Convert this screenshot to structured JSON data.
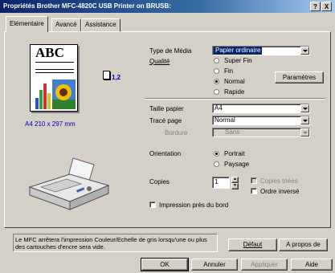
{
  "window": {
    "title": "Propriétés Brother MFC-4820C USB Printer on BRUSB:",
    "help_btn": "?",
    "close_btn": "X"
  },
  "tabs": [
    {
      "label": "Elémentaire",
      "active": true
    },
    {
      "label": "Avancé",
      "active": false
    },
    {
      "label": "Assistance",
      "active": false
    }
  ],
  "preview": {
    "logo_text": "ABC",
    "copies_badge": "1,2",
    "paper_label": "A4 210 x 297 mm"
  },
  "media": {
    "label": "Type de Média",
    "value": "Papier ordinaire"
  },
  "quality": {
    "label": "Qualité",
    "options": [
      {
        "label": "Super Fin",
        "selected": false
      },
      {
        "label": "Fin",
        "selected": false
      },
      {
        "label": "Normal",
        "selected": true
      },
      {
        "label": "Rapide",
        "selected": false
      }
    ],
    "settings_button": "Paramètres"
  },
  "paper_size": {
    "label": "Taille papier",
    "value": "A4"
  },
  "layout": {
    "label": "Tracé page",
    "value": "Normal"
  },
  "border": {
    "label": "Bordure",
    "value": "Sans"
  },
  "orientation": {
    "label": "Orientation",
    "options": [
      {
        "label": "Portrait",
        "selected": true
      },
      {
        "label": "Paysage",
        "selected": false
      }
    ]
  },
  "copies": {
    "label": "Copies",
    "value": "1",
    "collate_label": "Copies triées",
    "reverse_label": "Ordre inversé"
  },
  "near_edge": {
    "label": "Impression près du bord",
    "checked": false
  },
  "message": "Le MFC arrêtera l'impression Couleur/Echelle de gris lorsqu'une ou plus des cartouches d'encre sera vide.",
  "buttons": {
    "default": "Défaut",
    "about": "A propos de",
    "ok": "OK",
    "cancel": "Annuler",
    "apply": "Appliquer",
    "help": "Aide"
  },
  "colors": {
    "titlebar": "#0a246a",
    "face": "#d4d0c8",
    "link_blue": "#0000c0",
    "selection": "#0a246a"
  }
}
